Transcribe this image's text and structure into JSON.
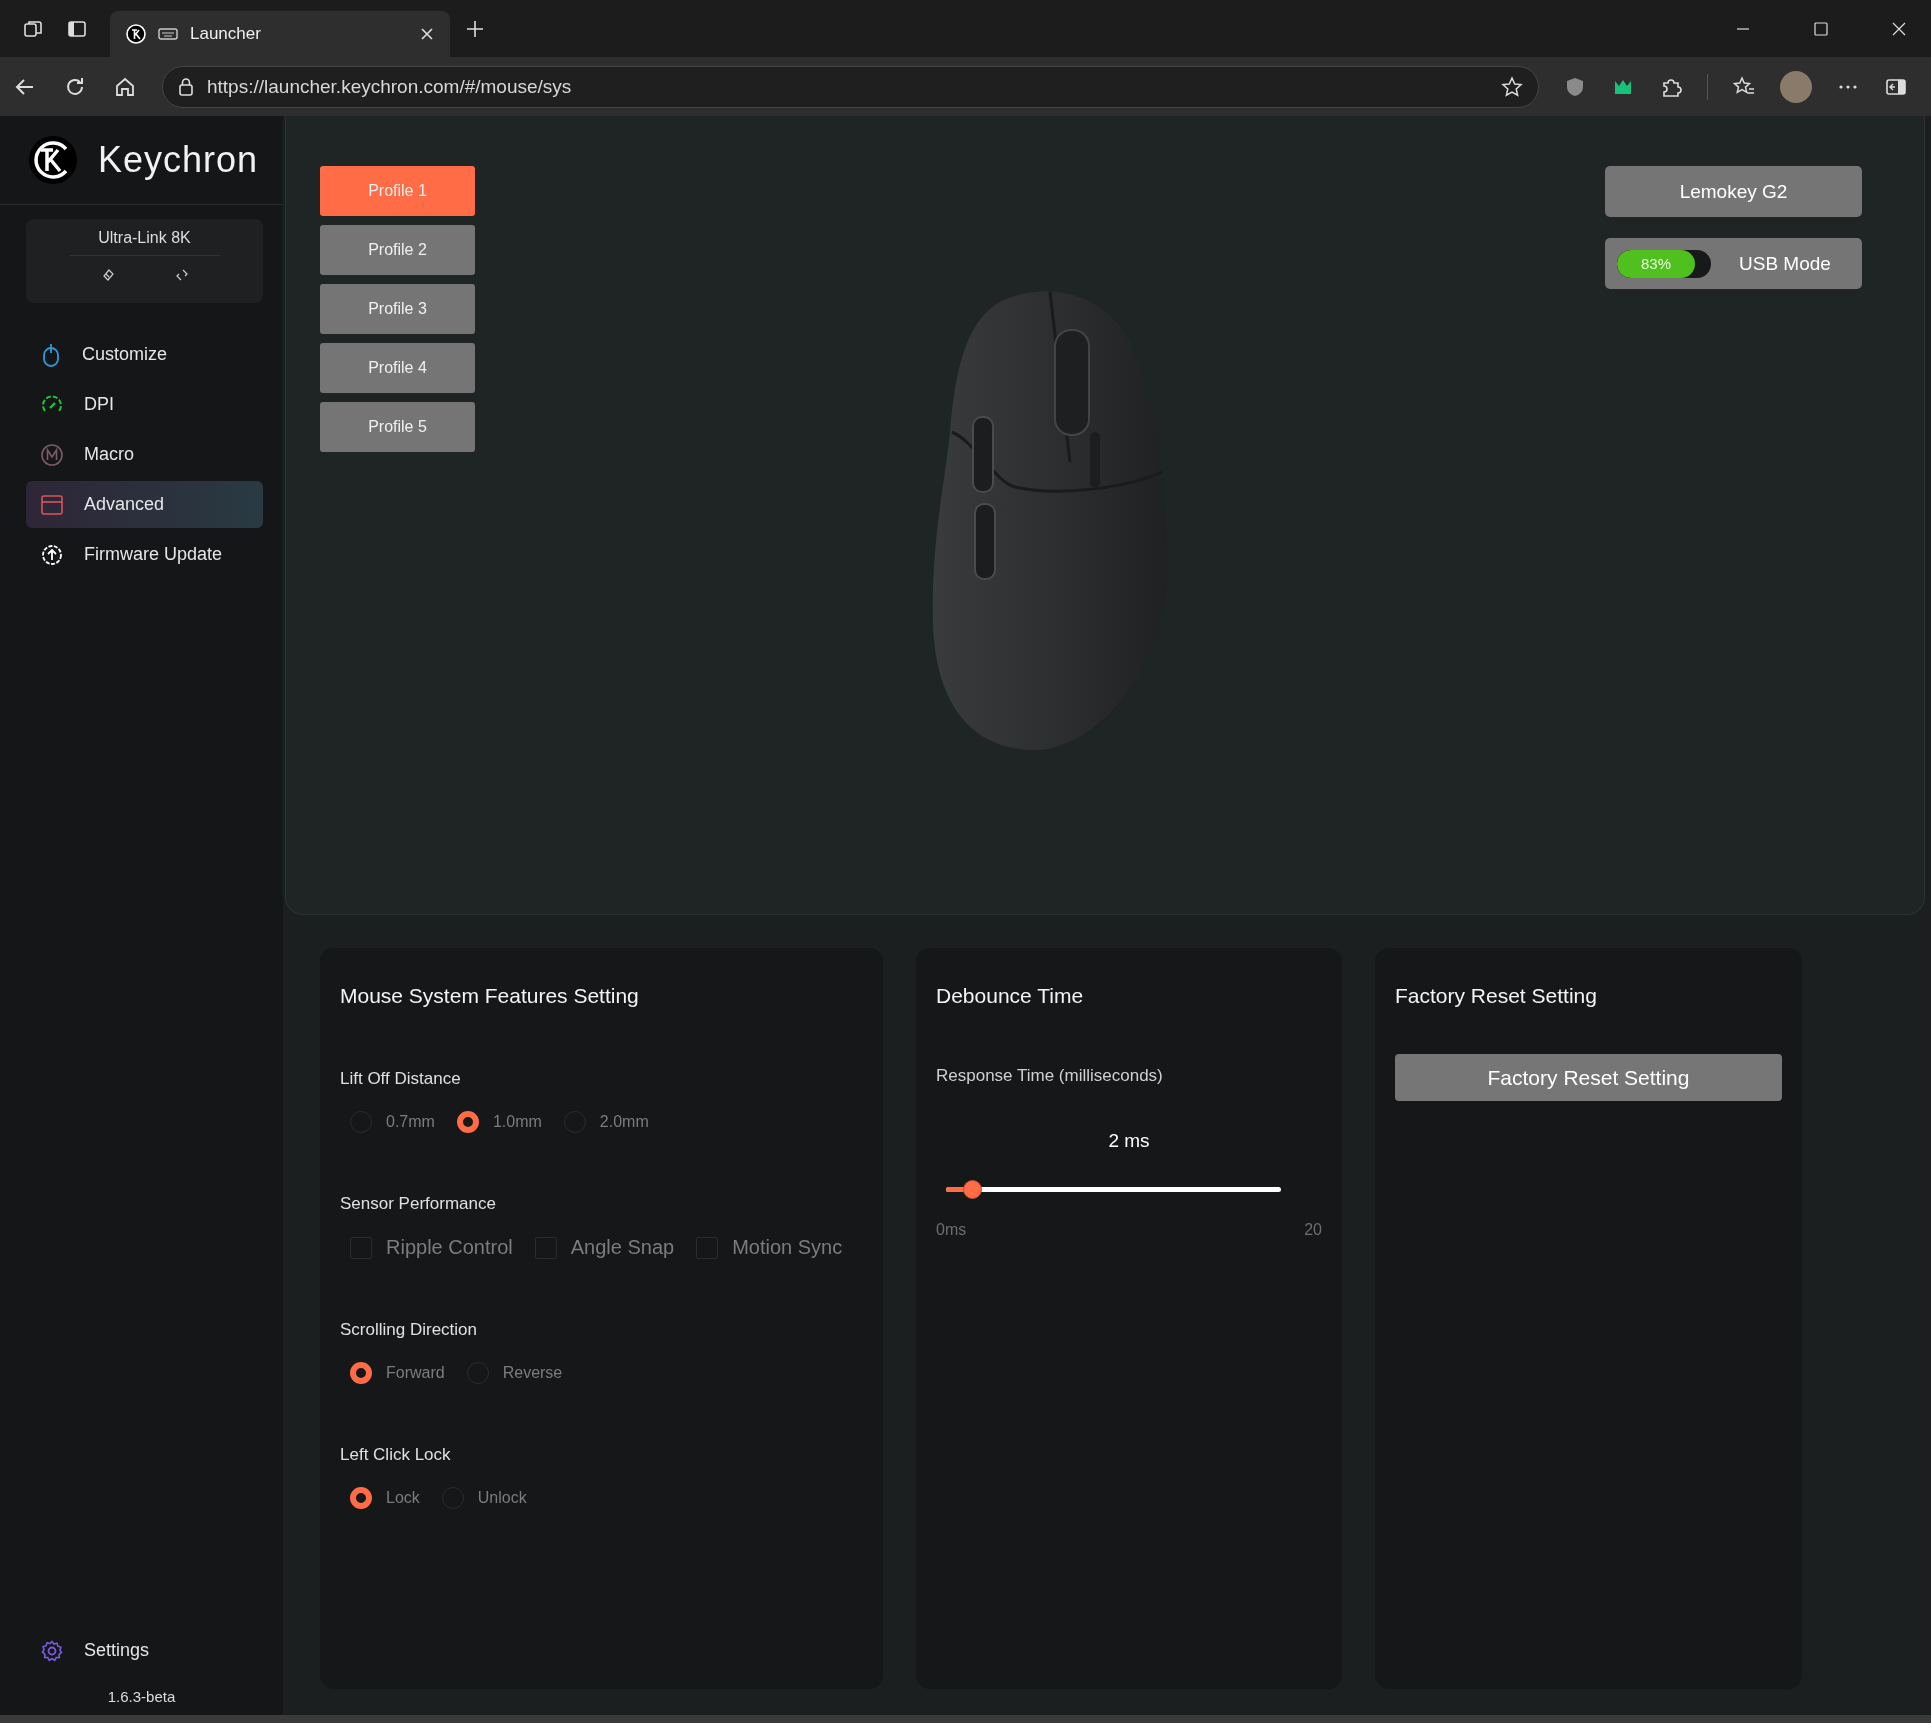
{
  "browser": {
    "tab_title": "Launcher",
    "url": "https://launcher.keychron.com/#/mouse/sys"
  },
  "sidebar": {
    "brand": "Keychron",
    "receiver": "Ultra-Link 8K",
    "items": [
      {
        "label": "Customize",
        "selected": false
      },
      {
        "label": "DPI",
        "selected": false
      },
      {
        "label": "Macro",
        "selected": false
      },
      {
        "label": "Advanced",
        "selected": true
      },
      {
        "label": "Firmware Update",
        "selected": false
      }
    ],
    "settings": "Settings",
    "version": "1.6.3-beta"
  },
  "profiles": [
    {
      "label": "Profile 1",
      "selected": true
    },
    {
      "label": "Profile 2",
      "selected": false
    },
    {
      "label": "Profile 3",
      "selected": false
    },
    {
      "label": "Profile 4",
      "selected": false
    },
    {
      "label": "Profile 5",
      "selected": false
    }
  ],
  "device": {
    "name": "Lemokey G2",
    "battery": {
      "level": 0.83,
      "reading": "83%"
    },
    "mode": "USB Mode"
  },
  "features": {
    "title": "Mouse System Features Setting",
    "groups": [
      {
        "label": "Lift Off Distance",
        "kind": "radio",
        "options": [
          {
            "label": "0.7mm",
            "selected": false
          },
          {
            "label": "1.0mm",
            "selected": true
          },
          {
            "label": "2.0mm",
            "selected": false
          }
        ]
      },
      {
        "label": "Sensor Performance",
        "kind": "checkbox",
        "options": [
          {
            "label": "Ripple Control",
            "checked": false
          },
          {
            "label": "Angle Snap",
            "checked": false
          },
          {
            "label": "Motion Sync",
            "checked": false
          }
        ]
      },
      {
        "label": "Scrolling Direction",
        "kind": "radio",
        "options": [
          {
            "label": "Forward",
            "selected": true
          },
          {
            "label": "Reverse",
            "selected": false
          }
        ]
      },
      {
        "label": "Left Click Lock",
        "kind": "radio",
        "options": [
          {
            "label": "Lock",
            "selected": true
          },
          {
            "label": "Unlock",
            "selected": false
          }
        ]
      }
    ]
  },
  "debounce": {
    "title": "Debounce Time",
    "label": "Response Time (milliseconds)",
    "value": "2 ms",
    "level": 0.1,
    "min": "0ms",
    "max": "20"
  },
  "reset": {
    "title": "Factory Reset Setting",
    "button": "Factory Reset Setting"
  }
}
